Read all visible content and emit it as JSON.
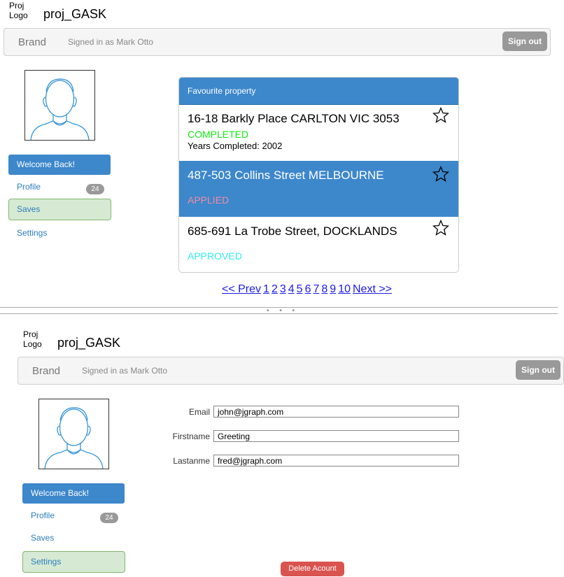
{
  "screen1": {
    "logo": {
      "line1": "Proj",
      "line2": "Logo"
    },
    "project_title": "proj_GASK",
    "navbar": {
      "brand": "Brand",
      "signed_in": "Signed in as Mark Otto",
      "sign_out": "Sign out"
    },
    "sidebar": {
      "items": [
        {
          "label": "Welcome Back!"
        },
        {
          "label": "Profile",
          "badge": "24"
        },
        {
          "label": "Saves"
        },
        {
          "label": "Settings"
        }
      ]
    },
    "panel": {
      "header": "Favourite property",
      "properties": [
        {
          "title": "16-18 Barkly Place CARLTON VIC 3053",
          "status": "COMPLETED",
          "status_color": "#11ee11",
          "detail": "Years Completed: 2002"
        },
        {
          "title": "487-503 Collins Street MELBOURNE",
          "status": "APPLIED",
          "status_color": "#f28ba0"
        },
        {
          "title": "685-691 La Trobe Street, DOCKLANDS",
          "status": "APPROVED",
          "status_color": "#33eeee"
        }
      ]
    },
    "pagination": {
      "prev": "<< Prev",
      "pages": [
        "1",
        "2",
        "3",
        "4",
        "5",
        "6",
        "7",
        "8",
        "9",
        "10"
      ],
      "next": "Next >>"
    }
  },
  "divider_dots": "• • •",
  "screen2": {
    "logo": {
      "line1": "Proj",
      "line2": "Logo"
    },
    "project_title": "proj_GASK",
    "navbar": {
      "brand": "Brand",
      "signed_in": "Signed in as Mark Otto",
      "sign_out": "Sign out"
    },
    "sidebar": {
      "items": [
        {
          "label": "Welcome Back!"
        },
        {
          "label": "Profile",
          "badge": "24"
        },
        {
          "label": "Saves"
        },
        {
          "label": "Settings"
        }
      ]
    },
    "form": {
      "email_label": "Email",
      "email_value": "john@jgraph.com",
      "firstname_label": "Firstname",
      "firstname_value": "Greeting",
      "lastname_label": "Lastanme",
      "lastname_value": "fred@jgraph.com"
    },
    "delete_button": "Delete Acount"
  },
  "colors": {
    "primary": "#3d87cb",
    "saves_bg": "#d6ead3",
    "danger": "#d9534f",
    "link": "#2a7dbd"
  }
}
